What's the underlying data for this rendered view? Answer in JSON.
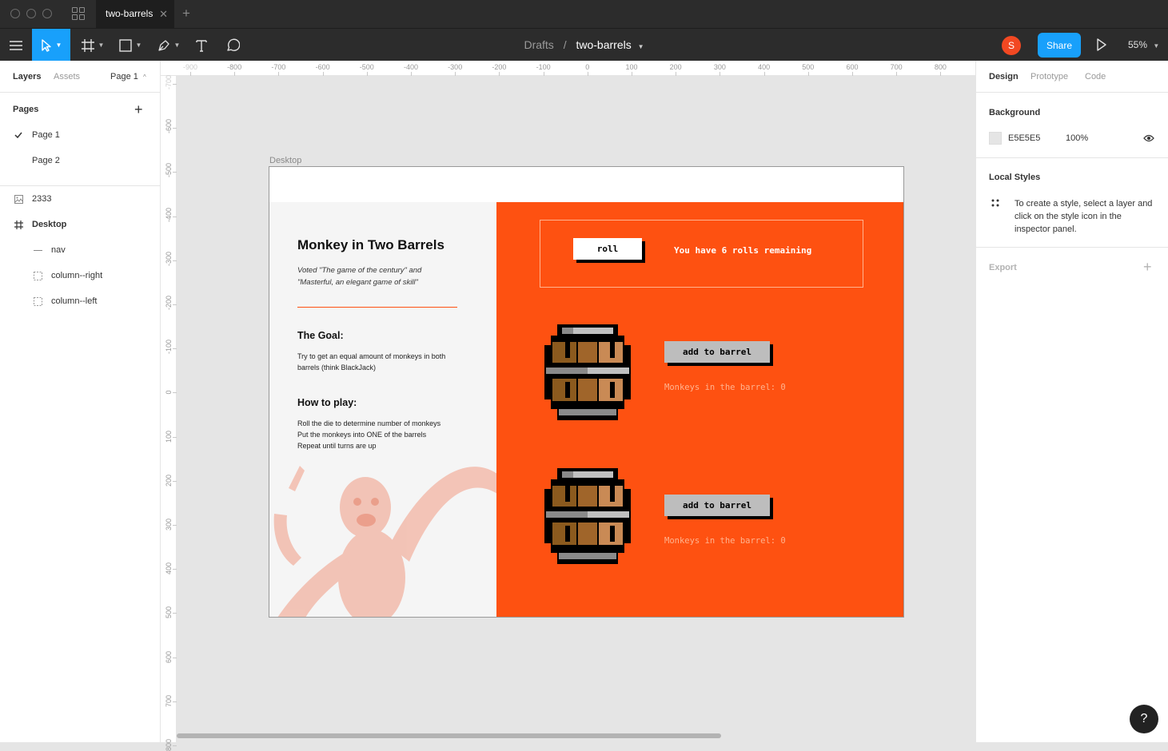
{
  "tab": {
    "title": "two-barrels",
    "close": "✕",
    "new": "+"
  },
  "toolbar": {
    "breadcrumb_parent": "Drafts",
    "breadcrumb_sep": "/",
    "file_name": "two-barrels",
    "avatar_initial": "S",
    "share_label": "Share",
    "zoom_label": "55%"
  },
  "left_panel": {
    "tabs": {
      "layers": "Layers",
      "assets": "Assets",
      "page_selector": "Page 1"
    },
    "pages_heading": "Pages",
    "add_page": "+",
    "pages": [
      {
        "label": "Page 1",
        "selected": true
      },
      {
        "label": "Page 2",
        "selected": false
      }
    ],
    "layers": [
      {
        "label": "2333",
        "icon": "image-icon",
        "indent": 0,
        "bold": false
      },
      {
        "label": "Desktop",
        "icon": "frame-icon",
        "indent": 0,
        "bold": true
      },
      {
        "label": "nav",
        "icon": "line-icon",
        "indent": 1,
        "bold": false
      },
      {
        "label": "column--right",
        "icon": "group-icon",
        "indent": 1,
        "bold": false
      },
      {
        "label": "column--left",
        "icon": "group-icon",
        "indent": 1,
        "bold": false
      }
    ]
  },
  "rulers": {
    "top": [
      "-900",
      "-800",
      "-700",
      "-600",
      "-500",
      "-400",
      "-300",
      "-200",
      "-100",
      "0",
      "100",
      "200",
      "300",
      "400",
      "500",
      "600",
      "700",
      "800"
    ],
    "left": [
      "-700",
      "-600",
      "-500",
      "-400",
      "-300",
      "-200",
      "-100",
      "0",
      "100",
      "200",
      "300",
      "400",
      "500",
      "600",
      "700",
      "800"
    ]
  },
  "frame": {
    "label": "Desktop",
    "title": "Monkey in Two Barrels",
    "quote": "Voted \"The game of the century\" and \"Masterful, an elegant game of skill\"",
    "goal_heading": "The Goal:",
    "goal_text": "Try to get an equal amount of monkeys in both barrels (think BlackJack)",
    "howto_heading": "How to play:",
    "howto_lines": [
      "Roll the die to determine number of monkeys",
      "Put the monkeys into ONE of the barrels",
      "Repeat until turns are up"
    ],
    "roll_label": "roll",
    "rolls_remaining": "You have 6 rolls remaining",
    "barrels": [
      {
        "button": "add to barrel",
        "count_text": "Monkeys in the barrel: 0"
      },
      {
        "button": "add to barrel",
        "count_text": "Monkeys in the barrel: 0"
      }
    ]
  },
  "right_panel": {
    "tabs": {
      "design": "Design",
      "prototype": "Prototype",
      "code": "Code"
    },
    "background_heading": "Background",
    "bg_hex": "E5E5E5",
    "bg_opacity": "100%",
    "local_styles_heading": "Local Styles",
    "local_styles_text": "To create a style, select a layer and click on the style icon in the inspector panel.",
    "export_heading": "Export",
    "export_add": "+"
  },
  "help_label": "?",
  "colors": {
    "accent": "#18a0fb",
    "orange": "#fe5111",
    "avatar": "#f24822",
    "canvas": "#e5e5e5"
  }
}
